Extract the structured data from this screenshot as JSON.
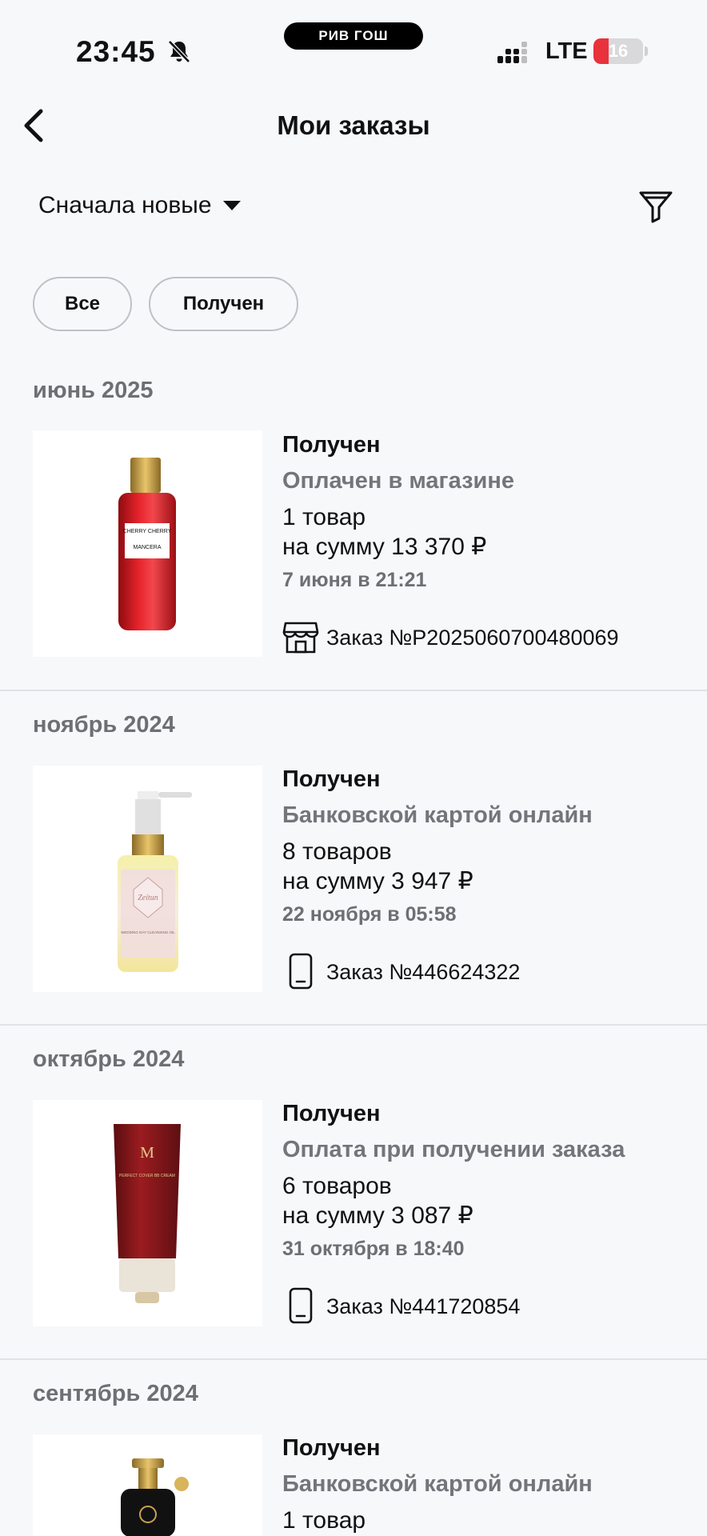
{
  "status_bar": {
    "time": "23:45",
    "carrier_badge": "РИВ ГОШ",
    "network": "LTE",
    "battery_level": "16",
    "battery_percent": 16
  },
  "header": {
    "title": "Мои заказы"
  },
  "sort": {
    "label": "Сначала новые"
  },
  "chips": [
    "Все",
    "Получен"
  ],
  "orders": [
    {
      "month": "июнь 2025",
      "status": "Получен",
      "payment": "Оплачен в магазине",
      "count": "1 товар",
      "sum": "на сумму 13 370 ₽",
      "date": "7 июня в 21:21",
      "channel_icon": "store-icon",
      "order_no": "Заказ №Р2025060700480069",
      "product_label_1": "CHERRY CHERRY",
      "product_label_2": "MANCERA"
    },
    {
      "month": "ноябрь 2024",
      "status": "Получен",
      "payment": "Банковской картой онлайн",
      "count": "8 товаров",
      "sum": "на сумму 3 947 ₽",
      "date": "22 ноября в 05:58",
      "channel_icon": "smartphone-icon",
      "order_no": "Заказ №446624322",
      "product_label_1": "Zeitun",
      "product_label_2": "WEDDING DAY CLEANSING OIL"
    },
    {
      "month": "октябрь 2024",
      "status": "Получен",
      "payment": "Оплата при получении заказа",
      "count": "6 товаров",
      "sum": "на сумму 3 087 ₽",
      "date": "31 октября в 18:40",
      "channel_icon": "smartphone-icon",
      "order_no": "Заказ №441720854",
      "product_label_1": "M",
      "product_label_2": "PERFECT COVER BB CREAM"
    },
    {
      "month": "сентябрь 2024",
      "status": "Получен",
      "payment": "Банковской картой онлайн",
      "count": "1 товар"
    }
  ],
  "colors": {
    "background": "#f7f8fa",
    "text_primary": "#111111",
    "text_secondary": "#74757a",
    "battery_low": "#e8323c"
  }
}
